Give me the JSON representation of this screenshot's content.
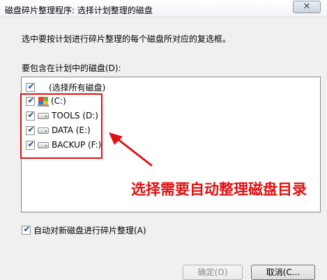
{
  "window": {
    "title": "磁盘碎片整理程序: 选择计划整理的磁盘",
    "close_glyph": "✕"
  },
  "instruction": "选中要按计划进行碎片整理的每个磁盘所对应的复选框。",
  "list_label": "要包含在计划中的磁盘(D):",
  "disks": [
    {
      "label": "(选择所有磁盘)",
      "checked": true,
      "icon": "none"
    },
    {
      "label": "(C:)",
      "checked": true,
      "icon": "windows-drive-icon"
    },
    {
      "label": "TOOLS (D:)",
      "checked": true,
      "icon": "drive-icon"
    },
    {
      "label": "DATA (E:)",
      "checked": true,
      "icon": "drive-icon"
    },
    {
      "label": "BACKUP (F:)",
      "checked": true,
      "icon": "drive-icon"
    }
  ],
  "check_glyph": "✔",
  "annotation": {
    "text": "选择需要自动整理磁盘目录",
    "color": "#e01010"
  },
  "auto_defrag": {
    "label": "自动对新磁盘进行碎片整理(A)",
    "checked": true
  },
  "buttons": {
    "ok": "确定(O)",
    "cancel": "取消(C..."
  },
  "watermark": "..."
}
